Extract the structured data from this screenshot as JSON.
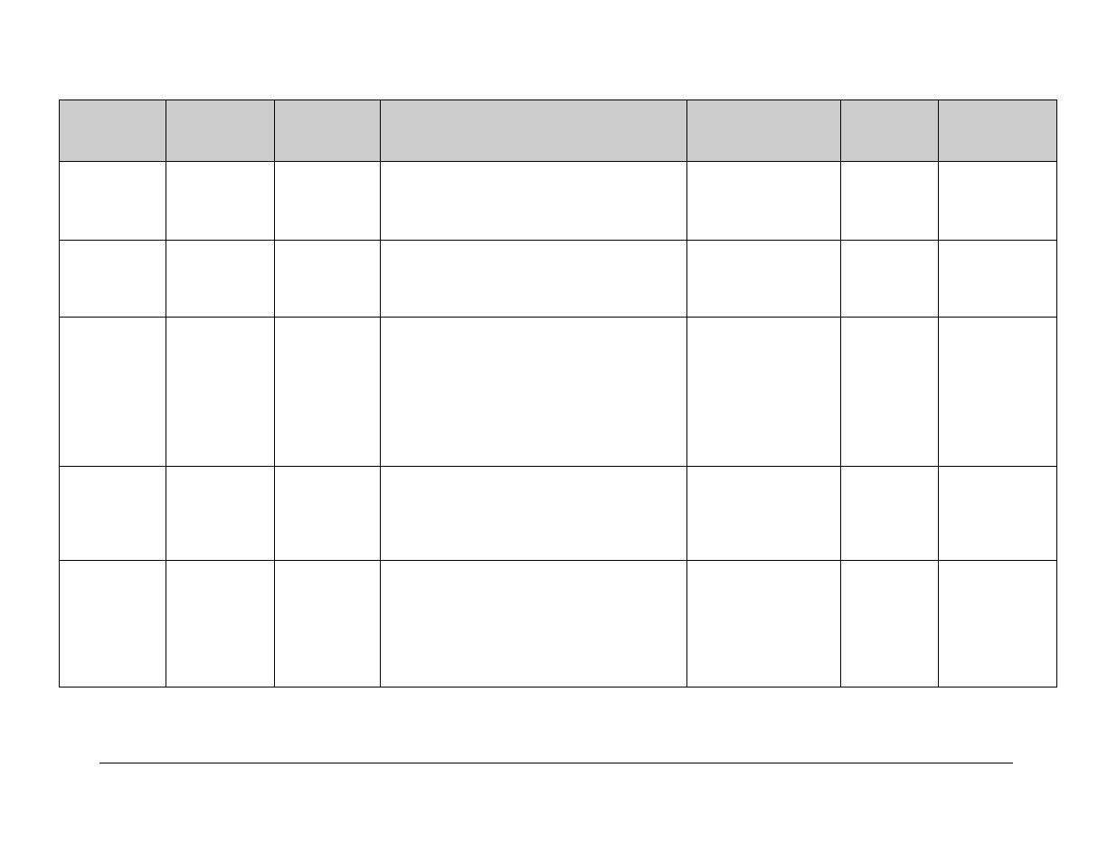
{
  "table": {
    "headers": [
      "",
      "",
      "",
      "",
      "",
      "",
      ""
    ],
    "rows": [
      [
        "",
        "",
        "",
        "",
        "",
        "",
        ""
      ],
      [
        "",
        "",
        "",
        "",
        "",
        "",
        ""
      ],
      [
        "",
        "",
        "",
        "",
        "",
        "",
        ""
      ],
      [
        "",
        "",
        "",
        "",
        "",
        "",
        ""
      ],
      [
        "",
        "",
        "",
        "",
        "",
        "",
        ""
      ]
    ]
  }
}
